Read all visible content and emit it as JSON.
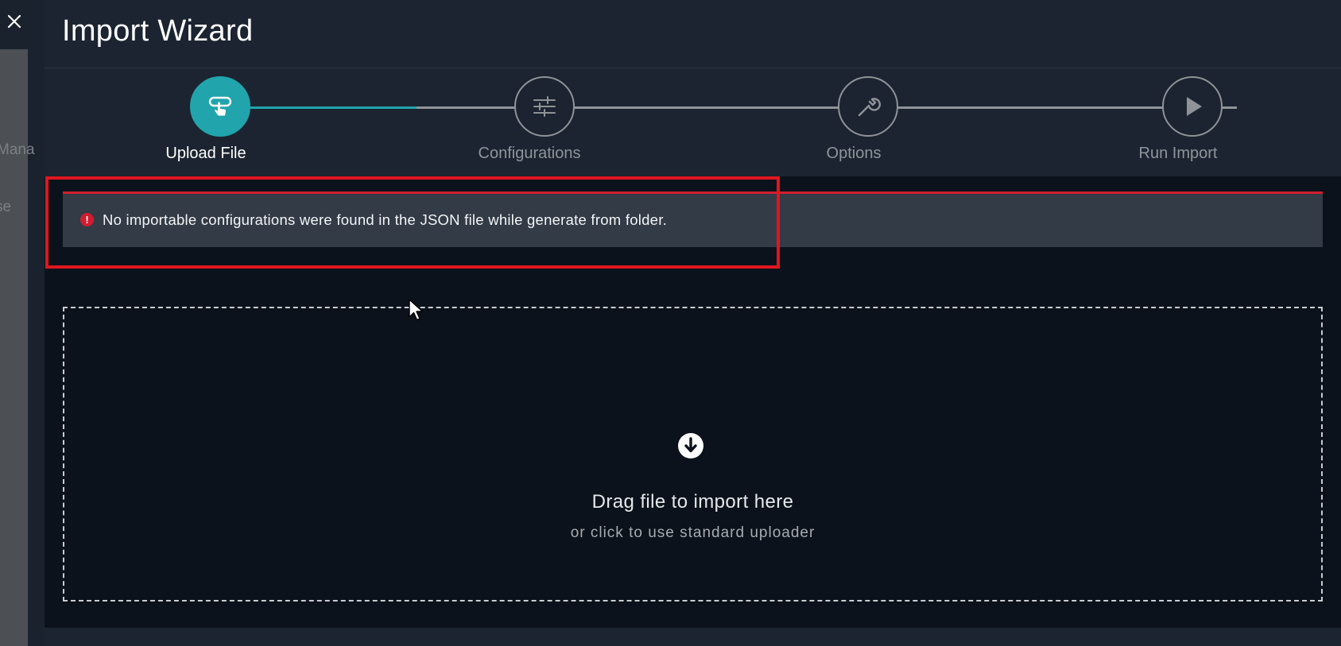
{
  "backdrop": {
    "fragment_1": "Mana",
    "fragment_2": "se"
  },
  "close_icon": "close-icon",
  "wizard": {
    "title": "Import Wizard"
  },
  "steps": [
    {
      "label": "Upload File",
      "icon": "upload-pointer-icon",
      "active": true
    },
    {
      "label": "Configurations",
      "icon": "sliders-icon",
      "active": false
    },
    {
      "label": "Options",
      "icon": "wrench-icon",
      "active": false
    },
    {
      "label": "Run Import",
      "icon": "play-icon",
      "active": false
    }
  ],
  "progress": 0.2,
  "alert": {
    "icon": "error-icon",
    "icon_glyph": "!",
    "message": "No importable configurations were found in the JSON file while generate from folder."
  },
  "dropzone": {
    "icon": "download-arrow-icon",
    "main_text": "Drag file to import here",
    "sub_text": "or click to use standard uploader"
  },
  "colors": {
    "accent": "#21a4ac",
    "error": "#d11c2f",
    "background": "#0b121b",
    "panel": "#1b2430"
  }
}
